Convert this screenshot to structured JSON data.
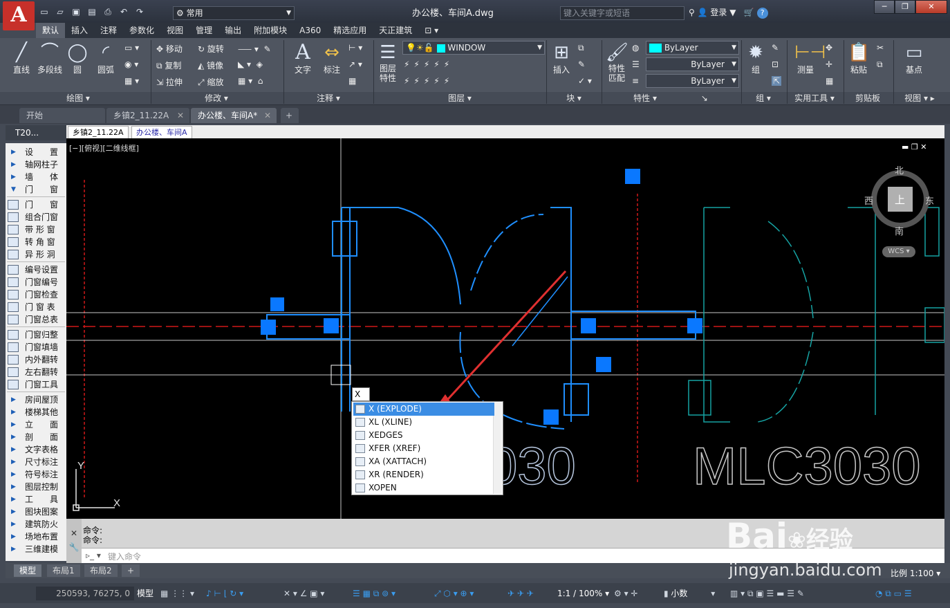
{
  "app": {
    "logo": "A",
    "title": "办公楼、车间A.dwg",
    "workspace": "常用",
    "search_placeholder": "键入关键字或短语",
    "login": "登录"
  },
  "ribbon_tabs": [
    "默认",
    "插入",
    "注释",
    "参数化",
    "视图",
    "管理",
    "输出",
    "附加模块",
    "A360",
    "精选应用",
    "天正建筑"
  ],
  "ribbon": {
    "draw": {
      "panel": "绘图",
      "line": "直线",
      "pline": "多段线",
      "circle": "圆",
      "arc": "圆弧"
    },
    "modify": {
      "panel": "修改",
      "move": "移动",
      "rotate": "旋转",
      "copy": "复制",
      "mirror": "镜像",
      "stretch": "拉伸",
      "scale": "缩放"
    },
    "annotation": {
      "panel": "注释",
      "text": "文字",
      "dim": "标注"
    },
    "layers": {
      "panel": "图层",
      "layer_props": "图层\n特性",
      "current_layer": "WINDOW"
    },
    "block": {
      "panel": "块",
      "insert": "插入"
    },
    "properties": {
      "panel": "特性",
      "match": "特性\n匹配",
      "color": "ByLayer",
      "linetype": "ByLayer",
      "lineweight": "ByLayer"
    },
    "groups": {
      "panel": "组",
      "group": "组"
    },
    "utilities": {
      "panel": "实用工具",
      "measure": "测量"
    },
    "clipboard": {
      "panel": "剪贴板",
      "paste": "粘贴"
    },
    "view": {
      "panel": "视图",
      "base": "基点"
    }
  },
  "doc_tabs": [
    "开始",
    "乡镇2_11.22A",
    "办公楼、车间A*"
  ],
  "t20": "T20...",
  "inner_tabs": [
    "乡镇2_11.22A",
    "办公楼、车间A"
  ],
  "sidebar": {
    "groups1": [
      "设　　置",
      "轴网柱子",
      "墙　　体",
      "门　　窗"
    ],
    "groups2": [
      "门　　窗",
      "组合门窗",
      "带 形 窗",
      "转 角 窗",
      "异 形 洞"
    ],
    "groups3": [
      "编号设置",
      "门窗编号",
      "门窗检查",
      "门 窗 表",
      "门窗总表"
    ],
    "groups4": [
      "门窗归整",
      "门窗填墙",
      "内外翻转",
      "左右翻转",
      "门窗工具"
    ],
    "groups5": [
      "房间屋顶",
      "楼梯其他",
      "立　　面",
      "剖　　面",
      "文字表格",
      "尺寸标注",
      "符号标注",
      "图层控制",
      "工　　具",
      "图块图案",
      "建筑防火",
      "场地布置",
      "三维建模"
    ]
  },
  "viewport": {
    "label": "[−][俯视][二维线框]",
    "compass": {
      "north": "北",
      "south": "南",
      "east": "东",
      "west": "西",
      "top": "上",
      "wcs": "WCS"
    },
    "label_right": "MLC3030",
    "label_left": "030",
    "ucs_x": "X",
    "ucs_y": "Y"
  },
  "autocomplete": {
    "typed": "X",
    "items": [
      "X (EXPLODE)",
      "XL (XLINE)",
      "XEDGES",
      "XFER (XREF)",
      "XA (XATTACH)",
      "XR (RENDER)",
      "XOPEN"
    ],
    "selected": 0
  },
  "command": {
    "history": [
      "命令:",
      "命令:"
    ],
    "placeholder": "键入命令"
  },
  "layout_tabs": [
    "模型",
    "布局1",
    "布局2"
  ],
  "status": {
    "coords": "250593, 76275, 0",
    "model": "模型",
    "annoscale": "1:1 / 100%",
    "units": "小数",
    "scale": "比例 1:100"
  },
  "colors": {
    "wall": "#1f8fff",
    "dim": "#e02020",
    "door2": "#16a3a3",
    "select": "#0a78ff"
  },
  "watermark": {
    "brand": "Bai",
    "brand2": "经验",
    "url": "jingyan.baidu.com"
  }
}
